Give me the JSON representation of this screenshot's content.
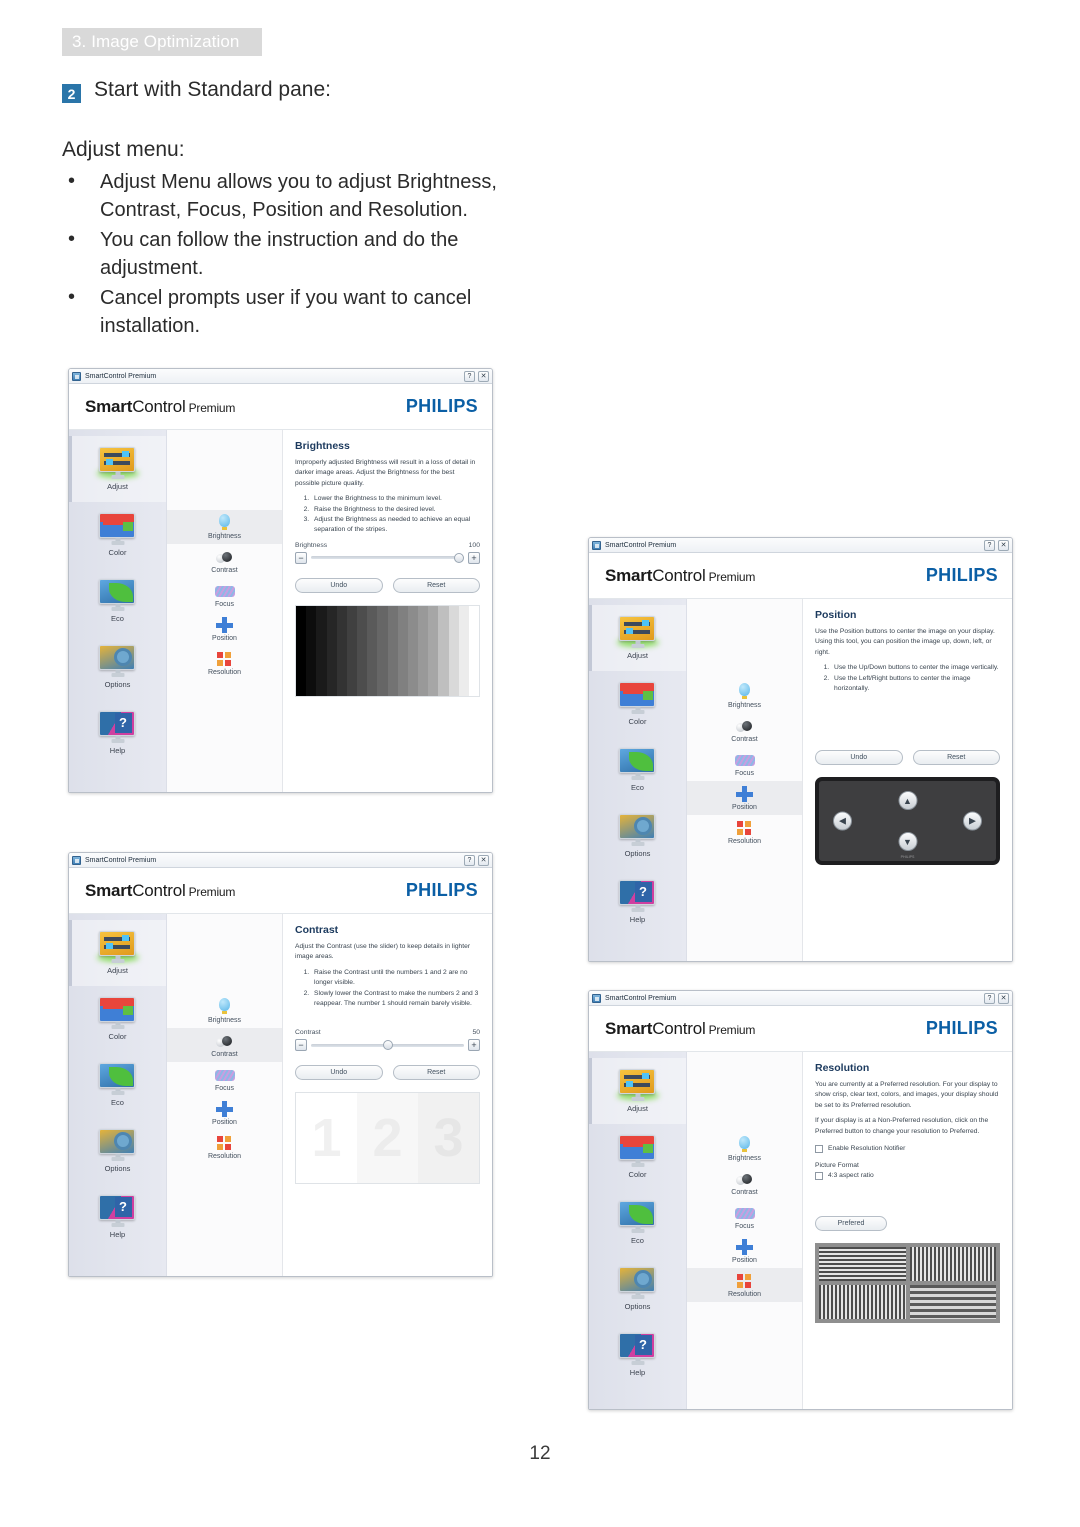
{
  "page": {
    "chapter_header": "3. Image Optimization",
    "page_number": "12",
    "step_number": "2",
    "step_title": "Start with Standard pane:",
    "section_title": "Adjust menu:",
    "bullets": [
      "Adjust Menu allows you to adjust Brightness, Contrast, Focus, Position and Resolution.",
      "You can follow the instruction and do the adjustment.",
      "Cancel prompts user if you want to cancel installation."
    ]
  },
  "app": {
    "window_title": "SmartControl Premium",
    "logo_smart": "Smart",
    "logo_control": "Control",
    "logo_premium": "Premium",
    "brand": "PHILIPS",
    "help_button": "?",
    "close_button": "✕",
    "rail": [
      {
        "label": "Adjust"
      },
      {
        "label": "Color"
      },
      {
        "label": "Eco"
      },
      {
        "label": "Options"
      },
      {
        "label": "Help"
      }
    ],
    "submenu": [
      {
        "label": "Brightness"
      },
      {
        "label": "Contrast"
      },
      {
        "label": "Focus"
      },
      {
        "label": "Position"
      },
      {
        "label": "Resolution"
      }
    ],
    "buttons": {
      "undo": "Undo",
      "reset": "Reset",
      "preferred": "Prefered"
    },
    "dpad": {
      "up": "▲",
      "down": "▼",
      "left": "◀",
      "right": "▶",
      "brand": "PHILIPS"
    }
  },
  "panels": {
    "brightness": {
      "title": "Brightness",
      "paragraph": "Improperly adjusted Brightness will result in a loss of detail in darker image areas. Adjust the Brightness for the best possible picture quality.",
      "steps": [
        "Lower the Brightness to the minimum level.",
        "Raise the Brightness to the desired level.",
        "Adjust the Brightness as needed to achieve an equal separation of the stripes."
      ],
      "slider_label": "Brightness",
      "slider_value": "100",
      "slider_percent": 100,
      "active_rail": "Adjust",
      "active_submenu": "Brightness"
    },
    "contrast": {
      "title": "Contrast",
      "paragraph": "Adjust the Contrast (use the slider) to keep details in lighter image areas.",
      "steps": [
        "Raise the Contrast until the numbers 1 and 2 are no longer visible.",
        "Slowly lower the Contrast to make the numbers 2 and 3 reappear. The number 1 should remain barely visible."
      ],
      "slider_label": "Contrast",
      "slider_value": "50",
      "slider_percent": 50,
      "active_rail": "Adjust",
      "active_submenu": "Contrast",
      "pattern_numbers": [
        "1",
        "2",
        "3"
      ]
    },
    "position": {
      "title": "Position",
      "paragraph": "Use the Position buttons to center the image on your display. Using this tool, you can position the image up, down, left, or right.",
      "steps": [
        "Use the Up/Down buttons to center the image vertically.",
        "Use the Left/Right buttons to center the image horizontally."
      ],
      "active_rail": "Adjust",
      "active_submenu": "Position"
    },
    "resolution": {
      "title": "Resolution",
      "paragraph_1": "You are currently at a Preferred resolution. For your display to show crisp, clear text, colors, and images, your display should be set to its Preferred resolution.",
      "paragraph_2": "If your display is at a Non-Preferred resolution, click on the Preferred button to change your resolution to Preferred.",
      "checkbox_notifier": "Enable Resolution Notifier",
      "picture_format_label": "Picture Format",
      "checkbox_aspect": "4:3 aspect ratio",
      "active_rail": "Adjust",
      "active_submenu": "Resolution"
    }
  },
  "colors": {
    "accent_blue": "#2a75a9",
    "philips_blue": "#0b5fa5",
    "header_band": "#d9d9d9",
    "pane_title": "#1c3a5e"
  }
}
